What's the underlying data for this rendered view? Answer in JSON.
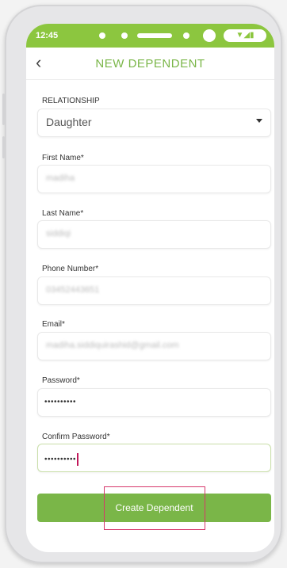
{
  "status": {
    "time": "12:45",
    "icons": "▼◢▮"
  },
  "header": {
    "back_icon": "‹",
    "title": "NEW DEPENDENT"
  },
  "form": {
    "relationship": {
      "label": "RELATIONSHIP",
      "value": "Daughter"
    },
    "first_name": {
      "label": "First Name*",
      "value": "madiha"
    },
    "last_name": {
      "label": "Last Name*",
      "value": "siddiqi"
    },
    "phone": {
      "label": "Phone Number*",
      "value": "03452443651"
    },
    "email": {
      "label": "Email*",
      "value": "madiha.siddiquirashid@gmail.com"
    },
    "password": {
      "label": "Password*",
      "value": "••••••••••"
    },
    "confirm_password": {
      "label": "Confirm Password*",
      "value": "••••••••••"
    }
  },
  "actions": {
    "create_label": "Create Dependent"
  },
  "colors": {
    "accent": "#7ab648",
    "highlight": "#d6386b"
  }
}
